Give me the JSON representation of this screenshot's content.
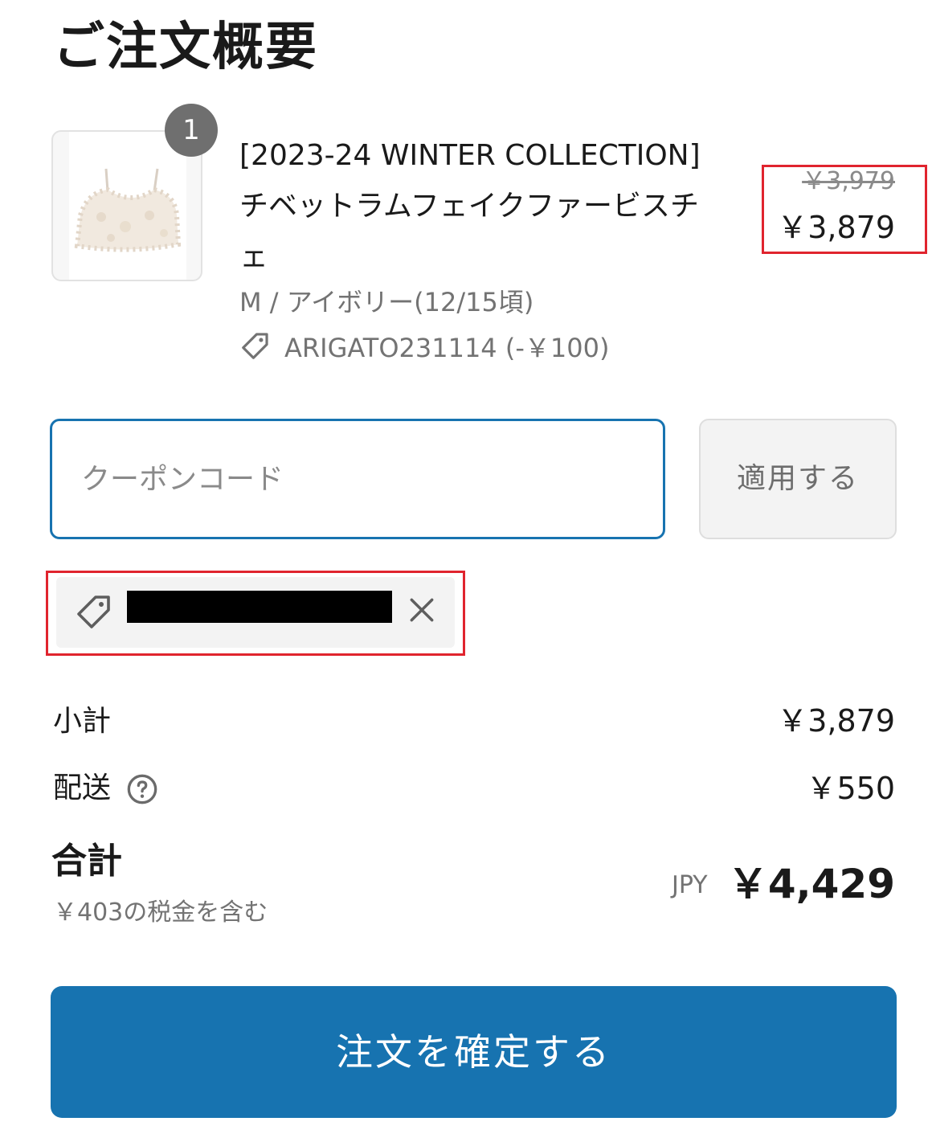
{
  "title": "ご注文概要",
  "product": {
    "quantity": "1",
    "name": "[2023-24 WINTER COLLECTION]チベットラムフェイクファービスチェ",
    "variant": "M / アイボリー(12/15頃)",
    "discount_label": "ARIGATO231114 (-￥100)",
    "price_original": "￥3,979",
    "price_current": "￥3,879",
    "image_icon": "product-image-fur-bustier"
  },
  "coupon": {
    "placeholder": "クーポンコード",
    "apply_label": "適用する",
    "applied_code": "",
    "tag_icon": "tag-icon",
    "remove_icon": "close-icon"
  },
  "summary": {
    "subtotal_label": "小計",
    "subtotal_value": "￥3,879",
    "shipping_label": "配送",
    "shipping_value": "￥550",
    "total_label": "合計",
    "tax_note": "￥403の税金を含む",
    "currency": "JPY",
    "total_value": "￥4,429"
  },
  "confirm_label": "注文を確定する",
  "colors": {
    "accent": "#1773b0",
    "highlight": "#e0242e"
  }
}
